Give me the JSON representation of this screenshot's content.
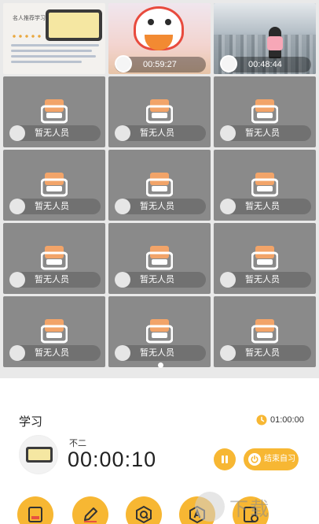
{
  "colors": {
    "accent": "#f7b733",
    "cell_bg": "#8a8a8a",
    "seat_orange": "#f2a469"
  },
  "grid": {
    "occupied": [
      {
        "icon": "document-preview",
        "timer": ""
      },
      {
        "icon": "lion-dance-image",
        "timer": "00:59:27"
      },
      {
        "icon": "city-photo",
        "timer": "00:48:44"
      }
    ],
    "occupied_doc_title": "名人推荐学习",
    "empty_label": "暂无人员"
  },
  "panel": {
    "section_title": "学习",
    "goal_time": "01:00:00",
    "user_name": "不二",
    "elapsed": "00:00:10",
    "end_button": "结束自习",
    "tools": [
      "book-icon",
      "pencil-icon",
      "q-search-icon",
      "a-letter-icon",
      "clock-doc-icon"
    ]
  },
  "watermark": "下载"
}
